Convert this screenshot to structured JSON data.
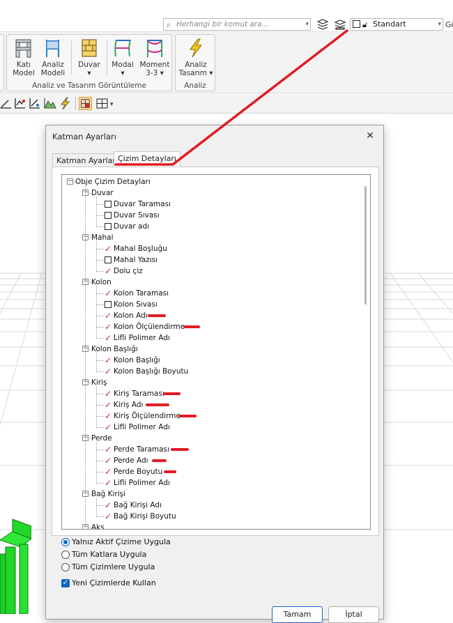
{
  "topbar": {
    "search_placeholder": "Herhangi bir komut ara...",
    "style_value": "Standart",
    "trailing_text": "Gö"
  },
  "ribbon": {
    "groups": [
      {
        "label": "Analiz ve Tasarım Görüntüleme"
      },
      {
        "label": "Analiz"
      }
    ],
    "buttons": {
      "kati_model": {
        "line1": "Katı",
        "line2": "Model"
      },
      "analiz_modeli": {
        "line1": "Analiz",
        "line2": "Modeli"
      },
      "duvar": {
        "line1": "Duvar",
        "line2": "▾"
      },
      "modal": {
        "line1": "Modal",
        "line2": "▾"
      },
      "moment": {
        "line1": "Moment",
        "line2": "3-3 ▾"
      },
      "analiz_tasarim": {
        "line1": "Analiz",
        "line2": "Tasarım ▾"
      }
    }
  },
  "dialog": {
    "title": "Katman Ayarları",
    "close_glyph": "✕",
    "tabs": [
      "Katman Ayarları",
      "Çizim Detayları"
    ],
    "active_tab": 1,
    "tree": [
      {
        "label": "Obje Çizim Detayları",
        "level": 0,
        "type": "root"
      },
      {
        "label": "Duvar",
        "level": 1,
        "type": "group"
      },
      {
        "label": "Duvar Taraması",
        "level": 2,
        "checked": false
      },
      {
        "label": "Duvar Sıvası",
        "level": 2,
        "checked": false
      },
      {
        "label": "Duvar adı",
        "level": 2,
        "checked": false
      },
      {
        "label": "Mahal",
        "level": 1,
        "type": "group"
      },
      {
        "label": "Mahal Boşluğu",
        "level": 2,
        "checked": true
      },
      {
        "label": "Mahal Yazısı",
        "level": 2,
        "checked": false
      },
      {
        "label": "Dolu çiz",
        "level": 2,
        "checked": true
      },
      {
        "label": "Kolon",
        "level": 1,
        "type": "group"
      },
      {
        "label": "Kolon Taraması",
        "level": 2,
        "checked": true
      },
      {
        "label": "Kolon Sıvası",
        "level": 2,
        "checked": false
      },
      {
        "label": "Kolon Adı",
        "level": 2,
        "checked": true
      },
      {
        "label": "Kolon Ölçülendirme",
        "level": 2,
        "checked": true
      },
      {
        "label": "Lifli Polimer Adı",
        "level": 2,
        "checked": true
      },
      {
        "label": "Kolon Başlığı",
        "level": 1,
        "type": "group"
      },
      {
        "label": "Kolon Başlığı",
        "level": 2,
        "checked": true
      },
      {
        "label": "Kolon Başlığı Boyutu",
        "level": 2,
        "checked": true
      },
      {
        "label": "Kiriş",
        "level": 1,
        "type": "group"
      },
      {
        "label": "Kiriş Taraması",
        "level": 2,
        "checked": true
      },
      {
        "label": "Kiriş Adı",
        "level": 2,
        "checked": true
      },
      {
        "label": "Kiriş Ölçülendirme",
        "level": 2,
        "checked": true
      },
      {
        "label": "Lifli Polimer Adı",
        "level": 2,
        "checked": true
      },
      {
        "label": "Perde",
        "level": 1,
        "type": "group"
      },
      {
        "label": "Perde Taraması",
        "level": 2,
        "checked": true
      },
      {
        "label": "Perde Adı",
        "level": 2,
        "checked": true
      },
      {
        "label": "Perde Boyutu",
        "level": 2,
        "checked": true
      },
      {
        "label": "Lifli Polimer Adı",
        "level": 2,
        "checked": true
      },
      {
        "label": "Bağ Kirişi",
        "level": 1,
        "type": "group"
      },
      {
        "label": "Bağ Kirişi Adı",
        "level": 2,
        "checked": true
      },
      {
        "label": "Bağ Kirişi Boyutu",
        "level": 2,
        "checked": true
      },
      {
        "label": "Aks",
        "level": 1,
        "type": "group"
      }
    ],
    "apply_options": [
      {
        "label": "Yalnız Aktif Çizime Uygula",
        "selected": true
      },
      {
        "label": "Tüm Katlara Uygula",
        "selected": false
      },
      {
        "label": "Tüm Çizimlere Uygula",
        "selected": false
      }
    ],
    "use_in_new": {
      "label": "Yeni Çizimlerde Kullan",
      "checked": true
    },
    "ok_label": "Tamam",
    "cancel_label": "İptal"
  },
  "colors": {
    "accent": "#1066c6",
    "checkmark": "#d0202a",
    "annotation": "#e01b24"
  }
}
